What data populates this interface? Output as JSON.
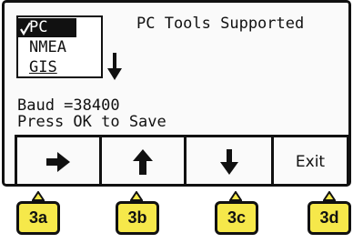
{
  "screen": {
    "title": "PC Tools Supported",
    "modes": [
      {
        "label": "PC",
        "selected": true,
        "checked": true
      },
      {
        "label": "NMEA",
        "selected": false
      },
      {
        "label": "GIS",
        "selected": false
      }
    ],
    "baud_line": "Baud =38400",
    "hint_line": "Press OK to Save"
  },
  "softkeys": [
    {
      "icon": "arrow-right-icon"
    },
    {
      "icon": "arrow-up-icon"
    },
    {
      "icon": "arrow-down-icon"
    },
    {
      "label": "Exit"
    }
  ],
  "hardware_keys": [
    {
      "label": "3a"
    },
    {
      "label": "3b"
    },
    {
      "label": "3c"
    },
    {
      "label": "3d"
    }
  ],
  "colors": {
    "key_fill": "#f6e84a",
    "lcd_ink": "#111111"
  }
}
